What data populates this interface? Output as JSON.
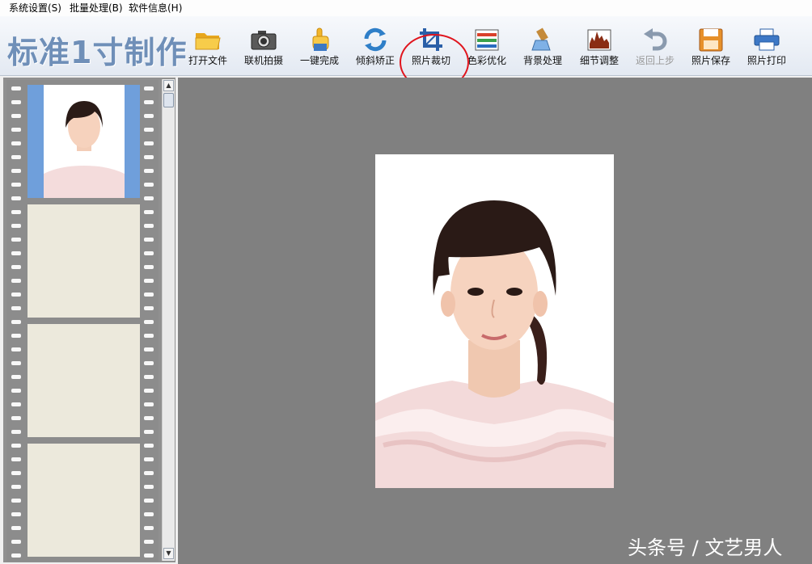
{
  "menu": [
    "系统设置(S)",
    "批量处理(B)",
    "软件信息(H)"
  ],
  "app_title": "标准1寸制作",
  "toolbar": [
    {
      "label": "打开文件",
      "icon": "folder-open-icon",
      "enabled": true
    },
    {
      "label": "联机拍摄",
      "icon": "camera-icon",
      "enabled": true
    },
    {
      "label": "一键完成",
      "icon": "pointing-hand-icon",
      "enabled": true
    },
    {
      "label": "倾斜矫正",
      "icon": "rotate-correct-icon",
      "enabled": true
    },
    {
      "label": "照片裁切",
      "icon": "crop-icon",
      "enabled": true,
      "highlighted": true
    },
    {
      "label": "色彩优化",
      "icon": "color-bars-icon",
      "enabled": true
    },
    {
      "label": "背景处理",
      "icon": "background-brush-icon",
      "enabled": true
    },
    {
      "label": "细节调整",
      "icon": "histogram-icon",
      "enabled": true
    },
    {
      "label": "返回上步",
      "icon": "undo-arrow-icon",
      "enabled": false
    },
    {
      "label": "照片保存",
      "icon": "floppy-save-icon",
      "enabled": true
    },
    {
      "label": "照片打印",
      "icon": "printer-icon",
      "enabled": true
    }
  ],
  "colors": {
    "title": "#6f8fb8",
    "highlight_ring": "#e0141d",
    "workspace_bg": "#808080",
    "filmstrip_bg": "#8c8c8c",
    "thumbnail_bg": "#6f9fdb",
    "empty_frame": "#ece9dc"
  },
  "filmstrip": {
    "frames": 4,
    "filled": 1
  },
  "watermark": "头条号 / 文艺男人"
}
